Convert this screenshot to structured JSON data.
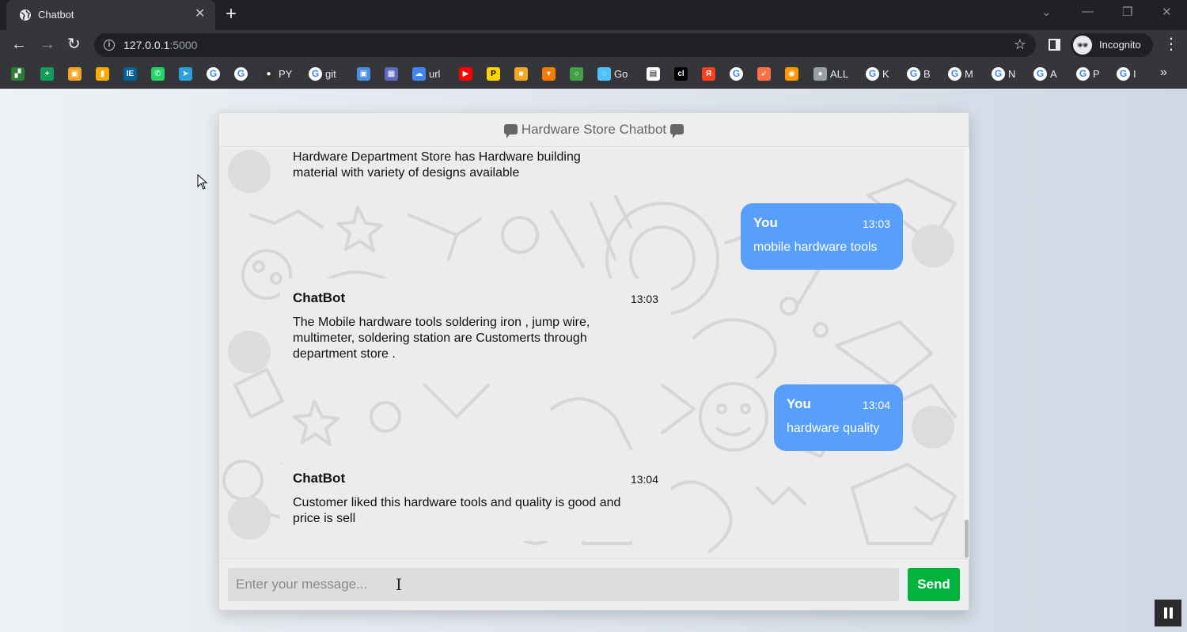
{
  "browser": {
    "tab_title": "Chatbot",
    "tab_close": "✕",
    "new_tab": "+",
    "url_host": "127.0.0.1",
    "url_port": ":5000",
    "profile_label": "Incognito",
    "bookmarks": [
      {
        "icon": "cashbook-icon",
        "label": "",
        "color": "#2e7d32"
      },
      {
        "icon": "sheets-plus-icon",
        "label": "",
        "color": "#0f9d58"
      },
      {
        "icon": "orange-app-icon",
        "label": "",
        "color": "#f5a623"
      },
      {
        "icon": "bar-chart-icon",
        "label": "",
        "color": "#f9ab00"
      },
      {
        "icon": "ieee-icon",
        "label": "",
        "color": "#00629b"
      },
      {
        "icon": "whatsapp-icon",
        "label": "",
        "color": "#25d366"
      },
      {
        "icon": "telegram-icon",
        "label": "",
        "color": "#2aa1da"
      },
      {
        "icon": "google-icon",
        "label": "",
        "color": "#ffffff"
      },
      {
        "icon": "google-icon",
        "label": "",
        "color": "#ffffff"
      },
      {
        "icon": "github-icon",
        "label": "PY",
        "color": "#333333"
      },
      {
        "icon": "google-icon",
        "label": "git",
        "color": "#ffffff"
      },
      {
        "icon": "window-icon",
        "label": "",
        "color": "#4a90e2"
      },
      {
        "icon": "store-icon",
        "label": "",
        "color": "#5c6bc0"
      },
      {
        "icon": "cloud-icon",
        "label": "url",
        "color": "#4285f4"
      },
      {
        "icon": "youtube-icon",
        "label": "",
        "color": "#ff0000"
      },
      {
        "icon": "p-icon",
        "label": "",
        "color": "#ffd400"
      },
      {
        "icon": "camera-icon",
        "label": "",
        "color": "#f5a623"
      },
      {
        "icon": "cart-icon",
        "label": "",
        "color": "#f57c00"
      },
      {
        "icon": "circle-icon",
        "label": "",
        "color": "#43a047"
      },
      {
        "icon": "swirl-icon",
        "label": "Go",
        "color": "#4fc3f7"
      },
      {
        "icon": "doc-icon",
        "label": "",
        "color": "#ffffff"
      },
      {
        "icon": "cl-icon",
        "label": "",
        "color": "#000000"
      },
      {
        "icon": "yandex-icon",
        "label": "",
        "color": "#fc3f1d"
      },
      {
        "icon": "google-icon",
        "label": "",
        "color": "#ffffff"
      },
      {
        "icon": "arrow-icon",
        "label": "",
        "color": "#ff7043"
      },
      {
        "icon": "eye-icon",
        "label": "",
        "color": "#ff9800"
      },
      {
        "icon": "globe-icon",
        "label": "ALL",
        "color": "#9aa0a6"
      },
      {
        "icon": "google-icon",
        "label": "K",
        "color": "#ffffff"
      },
      {
        "icon": "google-icon",
        "label": "B",
        "color": "#ffffff"
      },
      {
        "icon": "google-icon",
        "label": "M",
        "color": "#ffffff"
      },
      {
        "icon": "google-icon",
        "label": "N",
        "color": "#ffffff"
      },
      {
        "icon": "google-icon",
        "label": "A",
        "color": "#ffffff"
      },
      {
        "icon": "google-icon",
        "label": "P",
        "color": "#ffffff"
      },
      {
        "icon": "google-icon",
        "label": "I",
        "color": "#ffffff"
      }
    ]
  },
  "chat": {
    "header_title": "Hardware Store Chatbot",
    "messages": [
      {
        "sender": "bot",
        "name": "",
        "time": "",
        "text": [
          "Hardware Department Store has Hardware building",
          "material with variety of designs available"
        ]
      },
      {
        "sender": "user",
        "name": "You",
        "time": "13:03",
        "text": [
          "mobile hardware tools"
        ]
      },
      {
        "sender": "bot",
        "name": "ChatBot",
        "time": "13:03",
        "text": [
          "The Mobile hardware tools soldering iron , jump wire,",
          "multimeter, soldering station are Customerts through",
          "department store ."
        ]
      },
      {
        "sender": "user",
        "name": "You",
        "time": "13:04",
        "text": [
          "hardware quality"
        ]
      },
      {
        "sender": "bot",
        "name": "ChatBot",
        "time": "13:04",
        "text": [
          "Customer liked this hardware tools and quality is good and",
          "price is sell"
        ]
      }
    ],
    "input_placeholder": "Enter your message...",
    "send_label": "Send",
    "colors": {
      "user_bubble": "#579ffb",
      "bot_bubble": "#ececec",
      "send_button": "#00b33c"
    }
  }
}
